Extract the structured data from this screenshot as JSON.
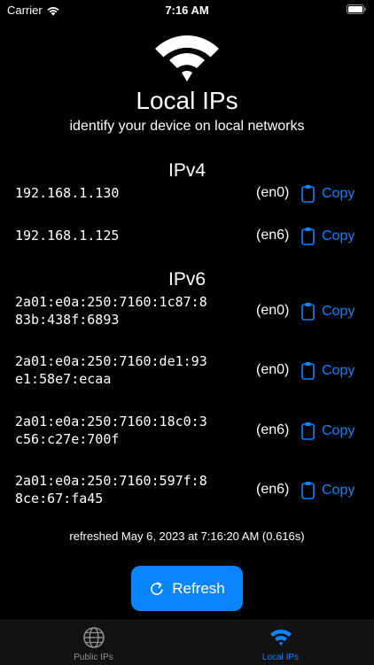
{
  "status_bar": {
    "carrier": "Carrier",
    "time": "7:16 AM"
  },
  "header": {
    "icon": "wifi-icon",
    "title": "Local IPs",
    "subtitle": "identify your device on local networks"
  },
  "ipv4": {
    "title": "IPv4",
    "rows": [
      {
        "address": "192.168.1.130",
        "interface": "(en0)",
        "copy_label": "Copy"
      },
      {
        "address": "192.168.1.125",
        "interface": "(en6)",
        "copy_label": "Copy"
      }
    ]
  },
  "ipv6": {
    "title": "IPv6",
    "rows": [
      {
        "address": "2a01:e0a:250:7160:1c87:8\n83b:438f:6893",
        "interface": "(en0)",
        "copy_label": "Copy"
      },
      {
        "address": "2a01:e0a:250:7160:de1:93\ne1:58e7:ecaa",
        "interface": "(en0)",
        "copy_label": "Copy"
      },
      {
        "address": "2a01:e0a:250:7160:18c0:3\nc56:c27e:700f",
        "interface": "(en6)",
        "copy_label": "Copy"
      },
      {
        "address": "2a01:e0a:250:7160:597f:8\n8ce:67:fa45",
        "interface": "(en6)",
        "copy_label": "Copy"
      }
    ]
  },
  "refreshed_text": "refreshed May 6, 2023 at 7:16:20 AM (0.616s)",
  "refresh_button": {
    "label": "Refresh",
    "icon": "refresh-icon"
  },
  "tabs": [
    {
      "label": "Public IPs",
      "icon": "globe-icon",
      "active": false
    },
    {
      "label": "Local IPs",
      "icon": "wifi-icon",
      "active": true
    }
  ],
  "colors": {
    "background": "#000000",
    "accent": "#0a84ff",
    "text": "#ffffff",
    "inactive_tab": "#8e8e93",
    "tab_bar": "#121212"
  }
}
